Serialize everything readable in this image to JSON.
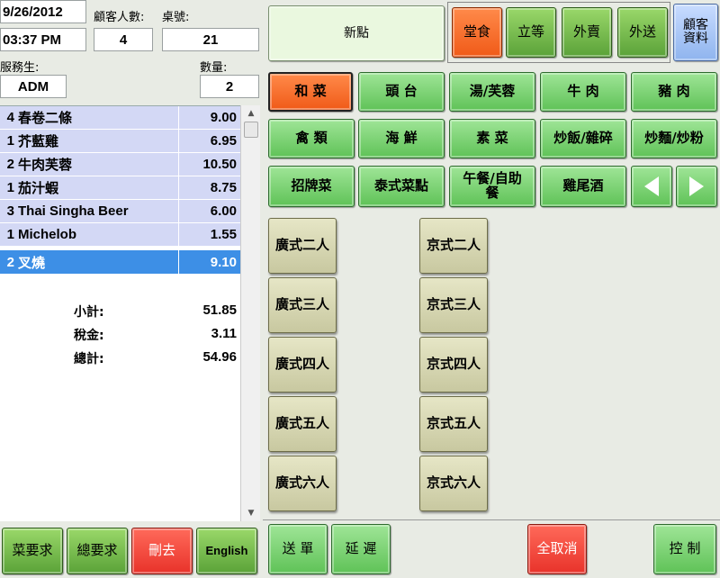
{
  "header": {
    "date": "9/26/2012",
    "time": "03:37 PM",
    "guests_label": "顧客人數:",
    "table_label": "桌號:",
    "guests_value": "4",
    "table_value": "21",
    "server_label": "服務生:",
    "server_value": "ADM",
    "qty_label": "數量:",
    "qty_value": "2"
  },
  "order": {
    "items": [
      {
        "qty": "4",
        "name": "春卷二條",
        "price": "9.00"
      },
      {
        "qty": "1",
        "name": "芥藍雞",
        "price": "6.95"
      },
      {
        "qty": "2",
        "name": "牛肉芙蓉",
        "price": "10.50"
      },
      {
        "qty": "1",
        "name": "茄汁蝦",
        "price": "8.75"
      },
      {
        "qty": "3",
        "name": "Thai Singha Beer",
        "price": "6.00"
      },
      {
        "qty": "1",
        "name": "Michelob",
        "price": "1.55"
      },
      {
        "qty": "2",
        "name": "叉燒",
        "price": "9.10"
      }
    ],
    "subtotal_label": "小計:",
    "subtotal": "51.85",
    "tax_label": "稅金:",
    "tax": "3.11",
    "total_label": "總計:",
    "total": "54.96"
  },
  "left_buttons": {
    "dish_request": "菜要求",
    "general_request": "總要求",
    "delete": "刪去",
    "english": "English"
  },
  "mode": {
    "new_order": "新點",
    "dine_in": "堂食",
    "wait": "立等",
    "takeout": "外賣",
    "delivery": "外送",
    "customer_info": "顧客資料"
  },
  "categories": [
    "和 菜",
    "頭 台",
    "湯/芙蓉",
    "牛 肉",
    "豬 肉",
    "禽 類",
    "海 鮮",
    "素 菜",
    "炒飯/雜碎",
    "炒麵/炒粉",
    "招牌菜",
    "泰式菜點",
    "午餐/自助餐",
    "雞尾酒"
  ],
  "menu_items": {
    "cantonese": [
      "廣式二人",
      "廣式三人",
      "廣式四人",
      "廣式五人",
      "廣式六人"
    ],
    "beijing": [
      "京式二人",
      "京式三人",
      "京式四人",
      "京式五人",
      "京式六人"
    ]
  },
  "bottom_buttons": {
    "send": "送 單",
    "delay": "延 遲",
    "cancel_all": "全取消",
    "control": "控 制"
  },
  "colors": {
    "green": "#6ccb62",
    "orange_selected": "#f26a2a",
    "red": "#e8322a",
    "tan": "#d4d4b0",
    "selected_row": "#3d8fe6",
    "item_row": "#d3d8f5"
  },
  "icons": {
    "prev": "triangle-left",
    "next": "triangle-right"
  }
}
